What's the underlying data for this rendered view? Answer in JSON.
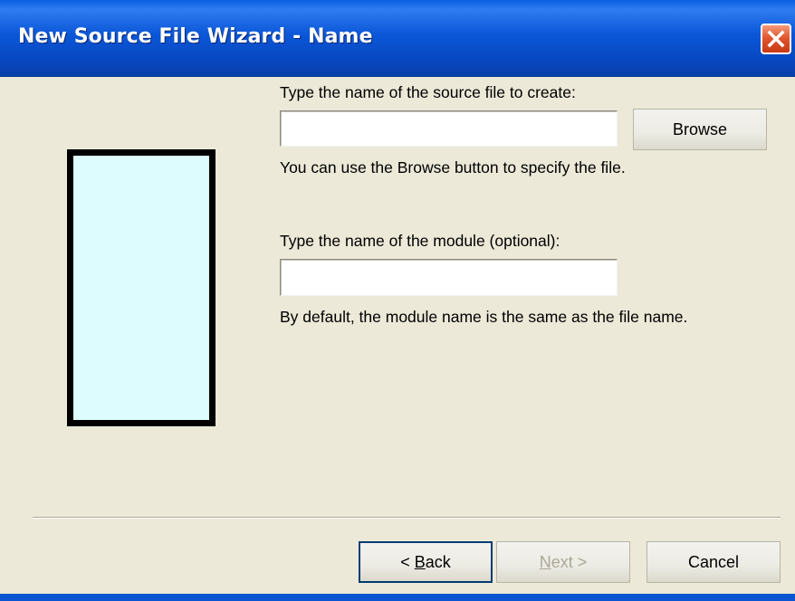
{
  "window": {
    "title": "New Source File Wizard - Name"
  },
  "form": {
    "source_label": "Type the name of the source file to create:",
    "source_value": "",
    "browse_label": "Browse",
    "browse_hint": "You can use the Browse button to specify the file.",
    "module_label": "Type the name of the module (optional):",
    "module_value": "",
    "module_hint": "By default, the module name is the same as the file name."
  },
  "buttons": {
    "back_prefix": "< ",
    "back_mnemonic": "B",
    "back_rest": "ack",
    "next_mnemonic": "N",
    "next_rest": "ext >",
    "cancel": "Cancel"
  },
  "colors": {
    "title_bar": "#0b57d8",
    "dialog_bg": "#ece9d8",
    "preview_fill": "#dcfcfe",
    "preview_border": "#000000",
    "disabled_text": "#aca899"
  },
  "icons": {
    "close": "close-x-icon"
  }
}
